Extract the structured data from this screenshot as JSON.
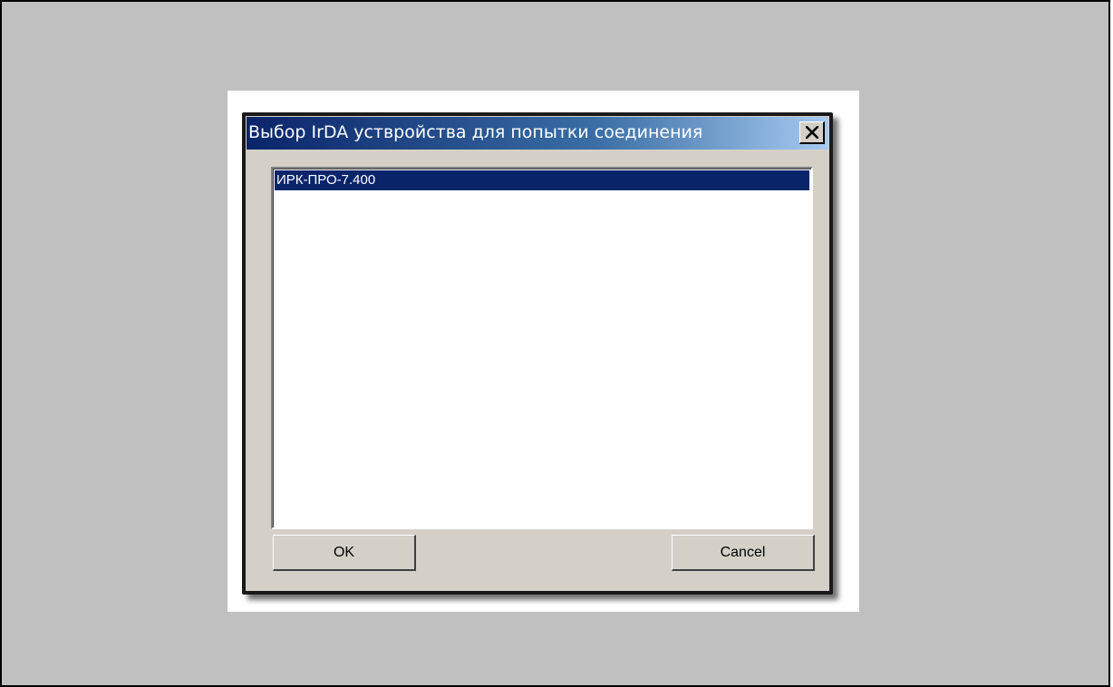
{
  "dialog": {
    "title": "Выбор IrDA уствройства для попытки соединения",
    "close_icon": "close-icon"
  },
  "device_list": {
    "items": [
      {
        "label": "ИРК-ПРО-7.400",
        "selected": true
      }
    ]
  },
  "buttons": {
    "ok_label": "OK",
    "cancel_label": "Cancel"
  },
  "colors": {
    "title_bar": "#0a246a",
    "selection": "#0a246a",
    "window_face": "#d4d0c8",
    "desktop": "#c0c0c0"
  }
}
